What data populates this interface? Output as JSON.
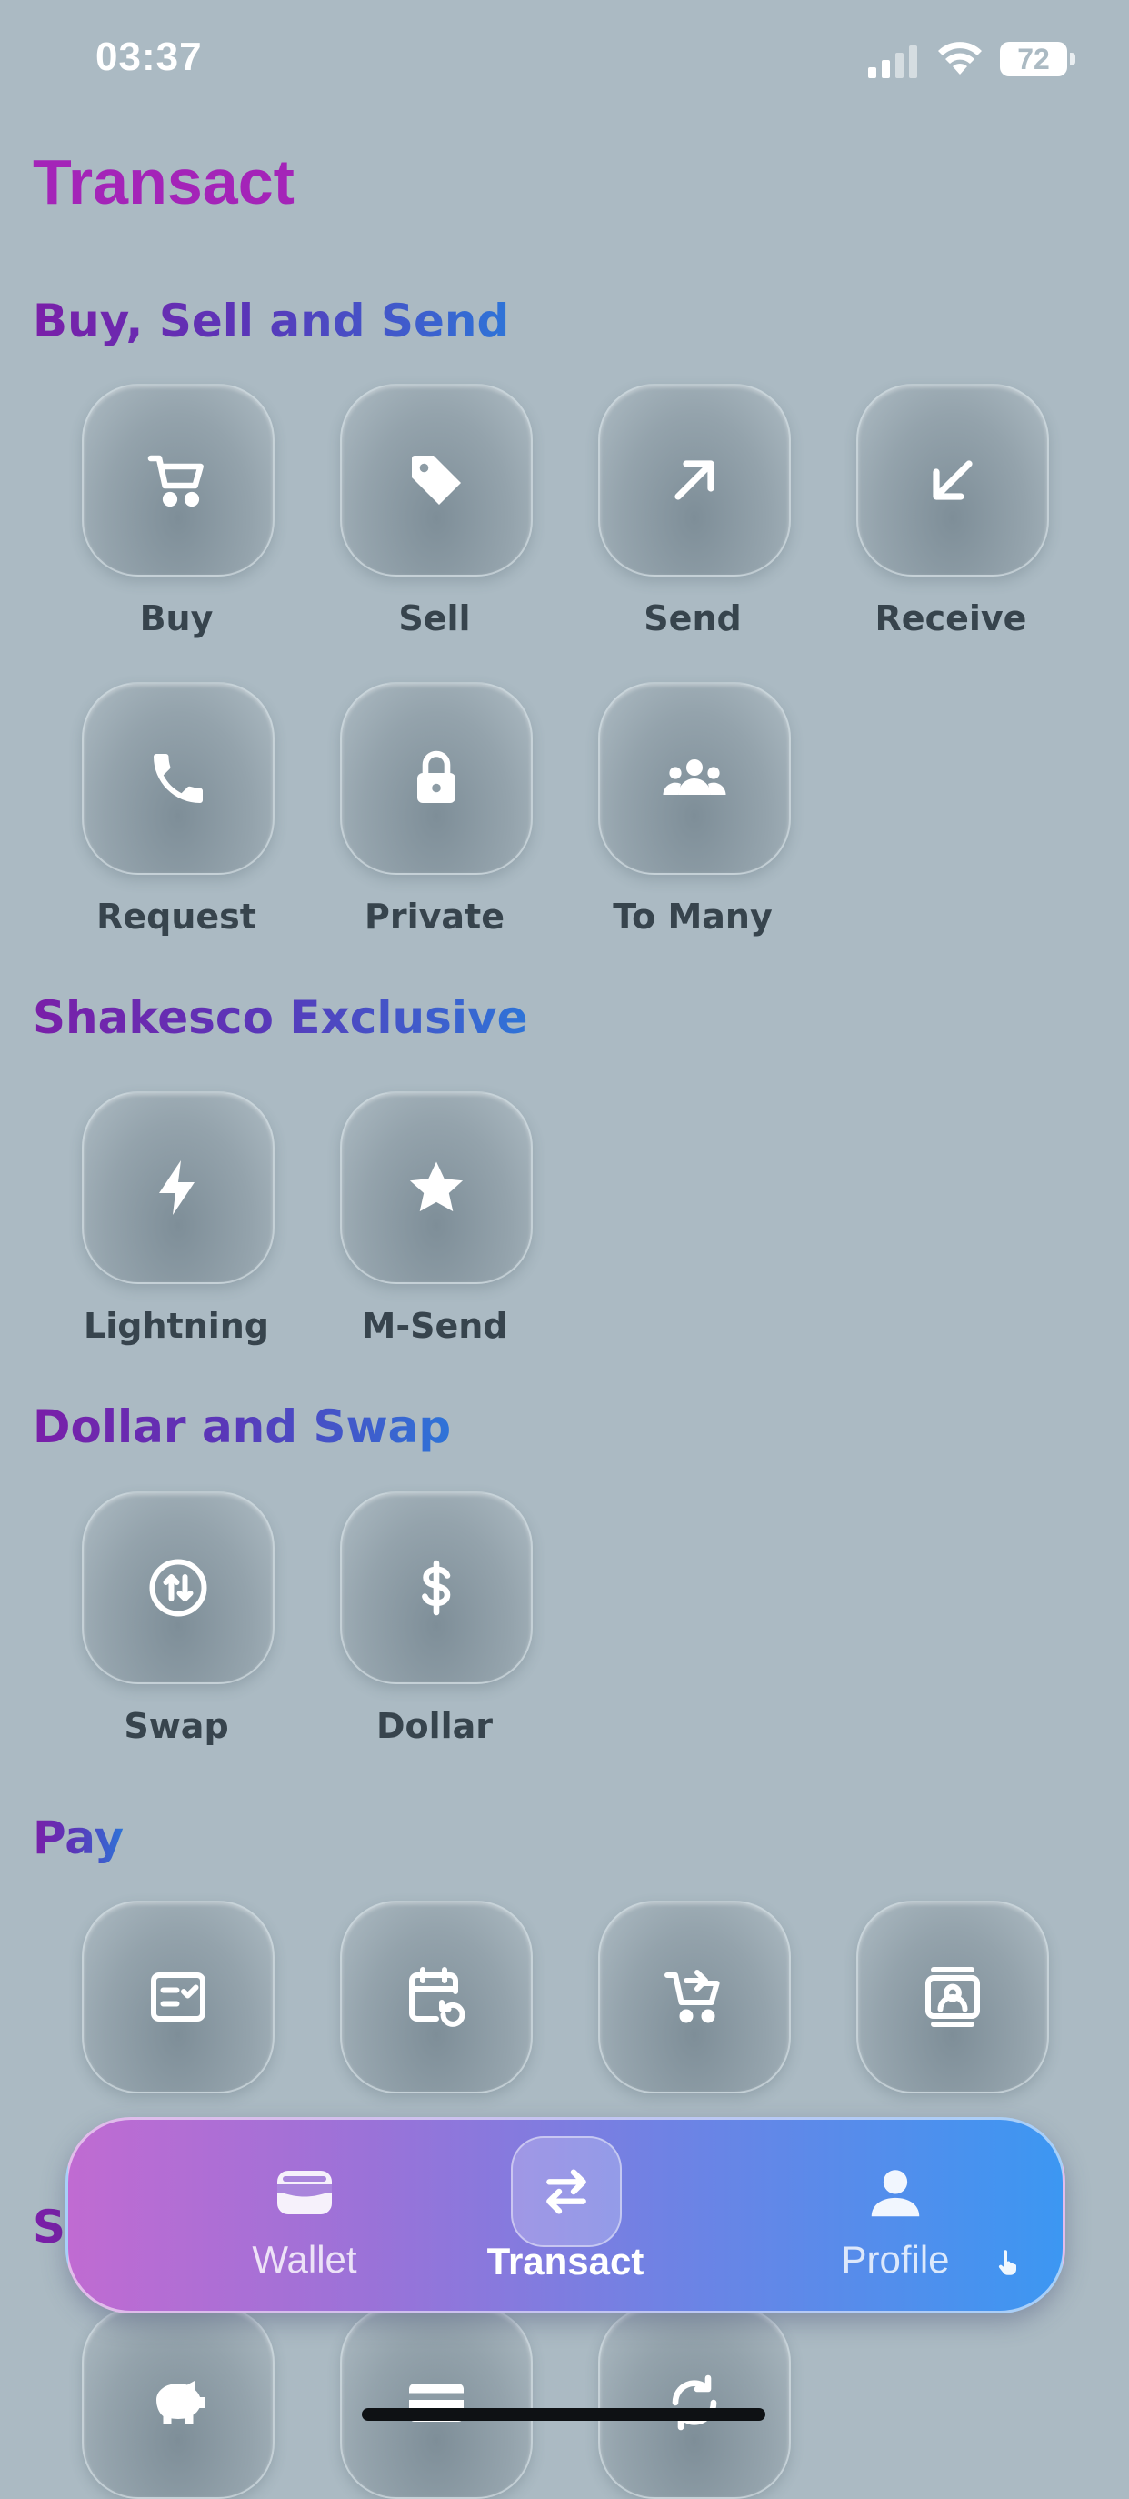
{
  "status_bar": {
    "time": "03:37",
    "battery": "72"
  },
  "page": {
    "title": "Transact"
  },
  "sections": [
    {
      "title": "Buy, Sell and Send",
      "items": [
        {
          "label": "Buy",
          "icon": "cart-icon"
        },
        {
          "label": "Sell",
          "icon": "tag-icon"
        },
        {
          "label": "Send",
          "icon": "arrow-up-right-icon"
        },
        {
          "label": "Receive",
          "icon": "arrow-down-left-icon"
        },
        {
          "label": "Request",
          "icon": "phone-icon"
        },
        {
          "label": "Private",
          "icon": "lock-icon"
        },
        {
          "label": "To Many",
          "icon": "group-icon"
        }
      ]
    },
    {
      "title": "Shakesco Exclusive",
      "items": [
        {
          "label": "Lightning",
          "icon": "lightning-icon"
        },
        {
          "label": "M-Send",
          "icon": "star-icon"
        }
      ]
    },
    {
      "title": "Dollar and Swap",
      "items": [
        {
          "label": "Swap",
          "icon": "swap-circle-icon"
        },
        {
          "label": "Dollar",
          "icon": "dollar-icon"
        }
      ]
    },
    {
      "title": "Pay",
      "items": [
        {
          "icon": "checklist-icon"
        },
        {
          "icon": "calendar-refresh-icon"
        },
        {
          "icon": "cart-arrow-icon"
        },
        {
          "icon": "contact-card-icon"
        }
      ]
    },
    {
      "title": "S",
      "items": [
        {
          "icon": "piggy-bank-icon"
        },
        {
          "icon": "credit-card-icon"
        },
        {
          "icon": "refresh-icon"
        }
      ]
    }
  ],
  "bottom_nav": {
    "items": [
      {
        "label": "Wallet",
        "icon": "wallet-icon",
        "active": false
      },
      {
        "label": "Transact",
        "icon": "transfer-icon",
        "active": true
      },
      {
        "label": "Profile",
        "icon": "person-icon",
        "active": false
      }
    ]
  },
  "colors": {
    "background": "#abbac3",
    "title": "#a424b8",
    "nav_gradient_start": "#c06bd2",
    "nav_gradient_end": "#3c97f2"
  }
}
